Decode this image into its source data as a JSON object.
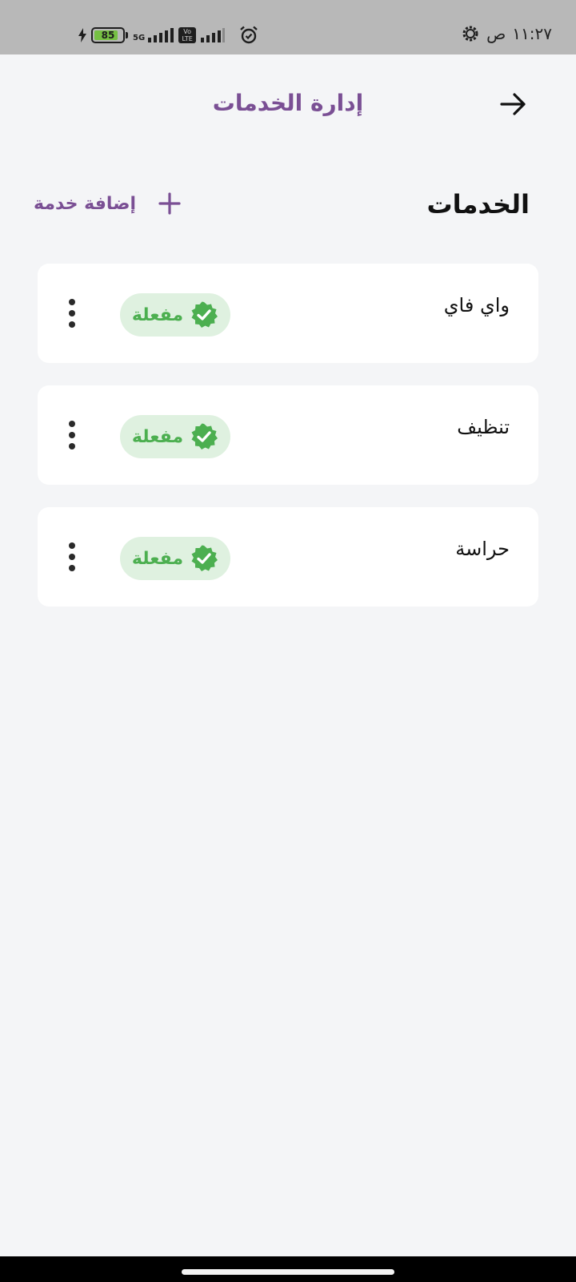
{
  "status_bar": {
    "time": "١١:٢٧",
    "am_pm": "ص",
    "battery_level": 85,
    "battery_label": "85",
    "network_label": "5G",
    "volte_label": "Vo LTE",
    "icons": [
      "settings-icon",
      "alarm-icon",
      "signal-icon",
      "volte-icon",
      "battery-icon",
      "charging-icon"
    ]
  },
  "header": {
    "title": "إدارة الخدمات",
    "back_icon": "arrow-right-icon"
  },
  "section": {
    "title": "الخدمات",
    "add_label": "إضافة خدمة",
    "add_icon": "plus-icon"
  },
  "services": [
    {
      "name": "واي فاي",
      "status": "مفعلة"
    },
    {
      "name": "تنظيف",
      "status": "مفعلة"
    },
    {
      "name": "حراسة",
      "status": "مفعلة"
    }
  ],
  "colors": {
    "accent": "#7a4f94",
    "active_green": "#4caf50",
    "badge_bg": "#dff1e0",
    "page_bg": "#f4f5f7",
    "battery_green": "#76c043"
  }
}
